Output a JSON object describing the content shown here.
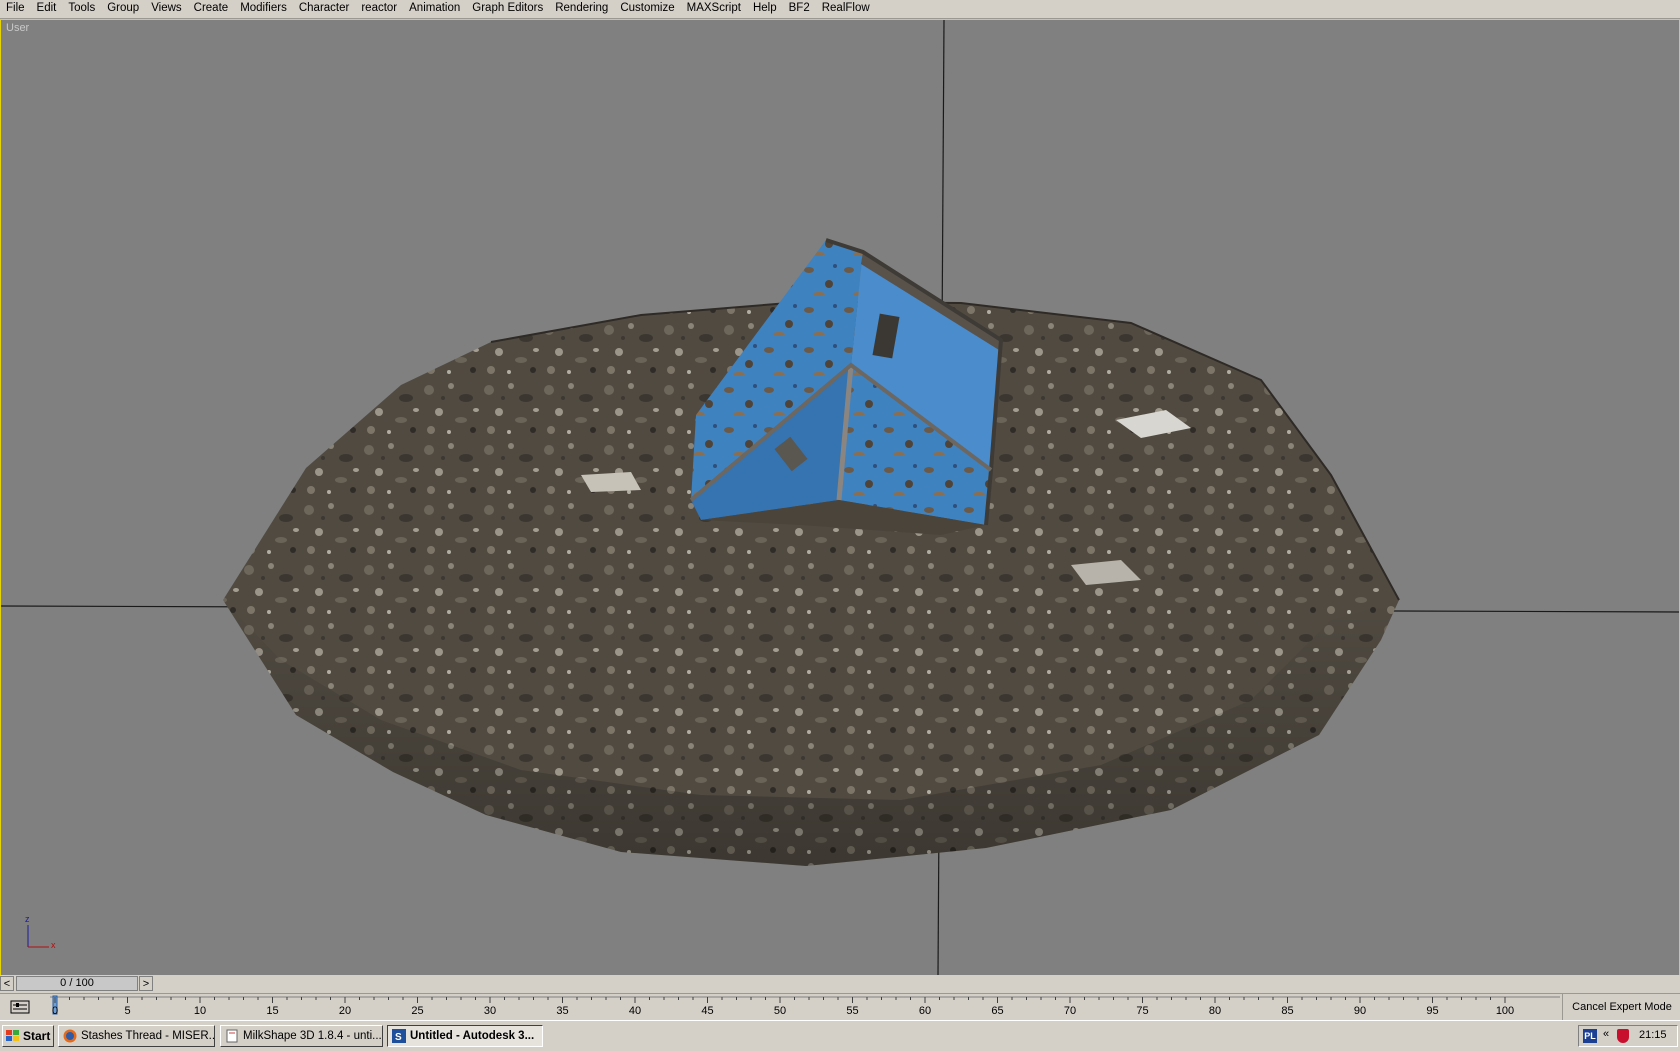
{
  "menu": [
    "File",
    "Edit",
    "Tools",
    "Group",
    "Views",
    "Create",
    "Modifiers",
    "Character",
    "reactor",
    "Animation",
    "Graph Editors",
    "Rendering",
    "Customize",
    "MAXScript",
    "Help",
    "BF2",
    "RealFlow"
  ],
  "viewport": {
    "label": "User",
    "axis": {
      "z": "z",
      "x": "x"
    },
    "colors": {
      "background": "#808080",
      "border": "#e6d400",
      "crate": "#3f82c0",
      "ground": "#514b42"
    }
  },
  "time_slider": {
    "value": "0 / 100",
    "prev": "<",
    "next": ">",
    "current_frame": 0,
    "total_frames": 100
  },
  "track_ticks": [
    "0",
    "5",
    "10",
    "15",
    "20",
    "25",
    "30",
    "35",
    "40",
    "45",
    "50",
    "55",
    "60",
    "65",
    "70",
    "75",
    "80",
    "85",
    "90",
    "95",
    "100"
  ],
  "cancel_expert_label": "Cancel Expert Mode",
  "taskbar": {
    "start_label": "Start",
    "tasks": [
      {
        "label": "Stashes Thread - MISER...",
        "icon": "firefox-icon",
        "active": false
      },
      {
        "label": "MilkShape 3D 1.8.4 - unti...",
        "icon": "milkshape-icon",
        "active": false
      },
      {
        "label": "Untitled - Autodesk 3...",
        "icon": "3dsmax-icon",
        "active": true
      }
    ],
    "tray": {
      "lang": "PL",
      "chevron": "«",
      "clock": "21:15"
    }
  }
}
